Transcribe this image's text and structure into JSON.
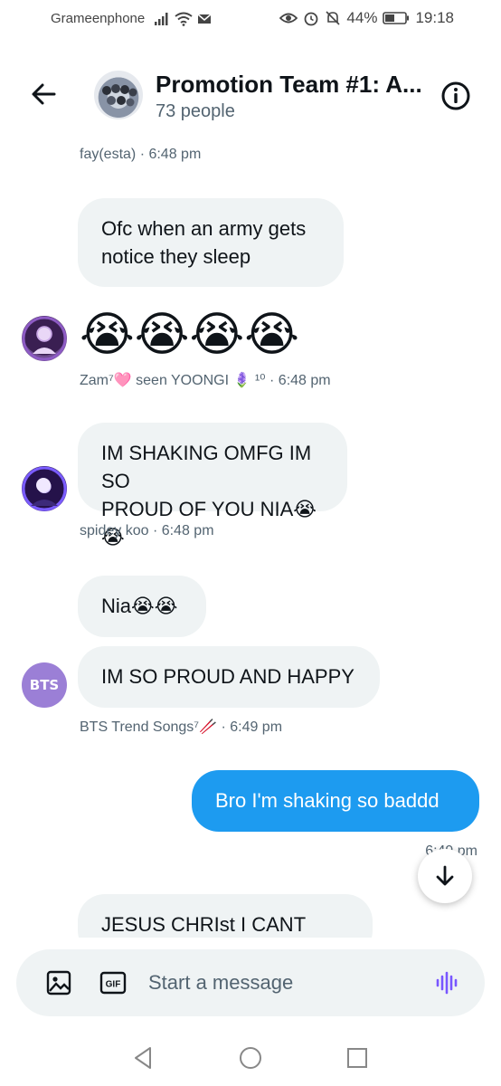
{
  "status_bar": {
    "carrier": "Grameenphone",
    "battery": "44%",
    "time": "19:18"
  },
  "header": {
    "title": "Promotion Team #1: A...",
    "subtitle": "73 people"
  },
  "messages": [
    {
      "meta": "fay(esta) · 6:48 pm"
    },
    {
      "text": "Ofc when an army gets\nnotice they sleep"
    },
    {
      "emoji": "😭😭😭😭"
    },
    {
      "meta": "Zam⁷🩷 seen YOONGI 🪻 ¹⁰ · 6:48 pm"
    },
    {
      "text": "IM SHAKING OMFG IM SO\nPROUD OF YOU NIA😭😭"
    },
    {
      "meta": "spidey koo · 6:48 pm"
    },
    {
      "text": "Nia😭😭"
    },
    {
      "text": "IM SO PROUD AND HAPPY"
    },
    {
      "meta": "BTS Trend Songs⁷🥢 · 6:49 pm"
    },
    {
      "text": "Bro I'm shaking so baddd"
    },
    {
      "meta": "6:49 pm"
    },
    {
      "text": "JESUS CHRIst I CANT"
    }
  ],
  "avatars": {
    "bts_logo_text": "BTS"
  },
  "composer": {
    "placeholder": "Start a message",
    "gif_label": "GIF"
  },
  "colors": {
    "accent": "#1d9bf0",
    "bubble_in": "#eff3f4",
    "muted_text": "#536471",
    "voice_icon": "#7856ff"
  },
  "icons": {
    "back": "arrow-left-icon",
    "info": "info-icon",
    "media": "image-icon",
    "gif": "gif-icon",
    "voice": "voice-wave-icon",
    "scroll": "arrow-down-icon"
  }
}
